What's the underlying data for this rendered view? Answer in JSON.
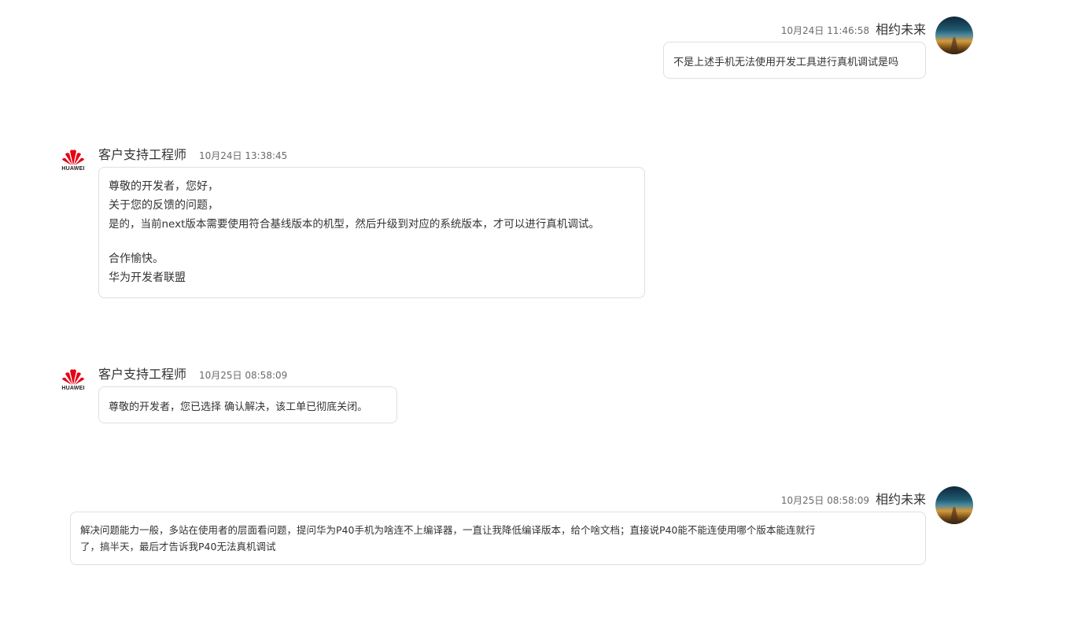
{
  "messages": [
    {
      "time": "10月24日 11:46:58",
      "name": "相约未来",
      "text": "不是上述手机无法使用开发工具进行真机调试是吗"
    },
    {
      "name": "客户支持工程师",
      "time": "10月24日 13:38:45",
      "logo_text": "HUAWEI",
      "lines": [
        "尊敬的开发者，您好，",
        "关于您的反馈的问题，",
        "是的，当前next版本需要使用符合基线版本的机型，然后升级到对应的系统版本，才可以进行真机调试。",
        "",
        "合作愉快。",
        "华为开发者联盟"
      ]
    },
    {
      "name": "客户支持工程师",
      "time": "10月25日 08:58:09",
      "logo_text": "HUAWEI",
      "text": "尊敬的开发者，您已选择 确认解决，该工单已彻底关闭。"
    },
    {
      "time": "10月25日 08:58:09",
      "name": "相约未来",
      "lines": [
        "解决问题能力一般，多站在使用者的层面看问题，提问华为P40手机为啥连不上编译器，一直让我降低编译版本，给个啥文档；直接说P40能不能连使用哪个版本能连就行",
        "了，搞半天，最后才告诉我P40无法真机调试"
      ]
    }
  ]
}
